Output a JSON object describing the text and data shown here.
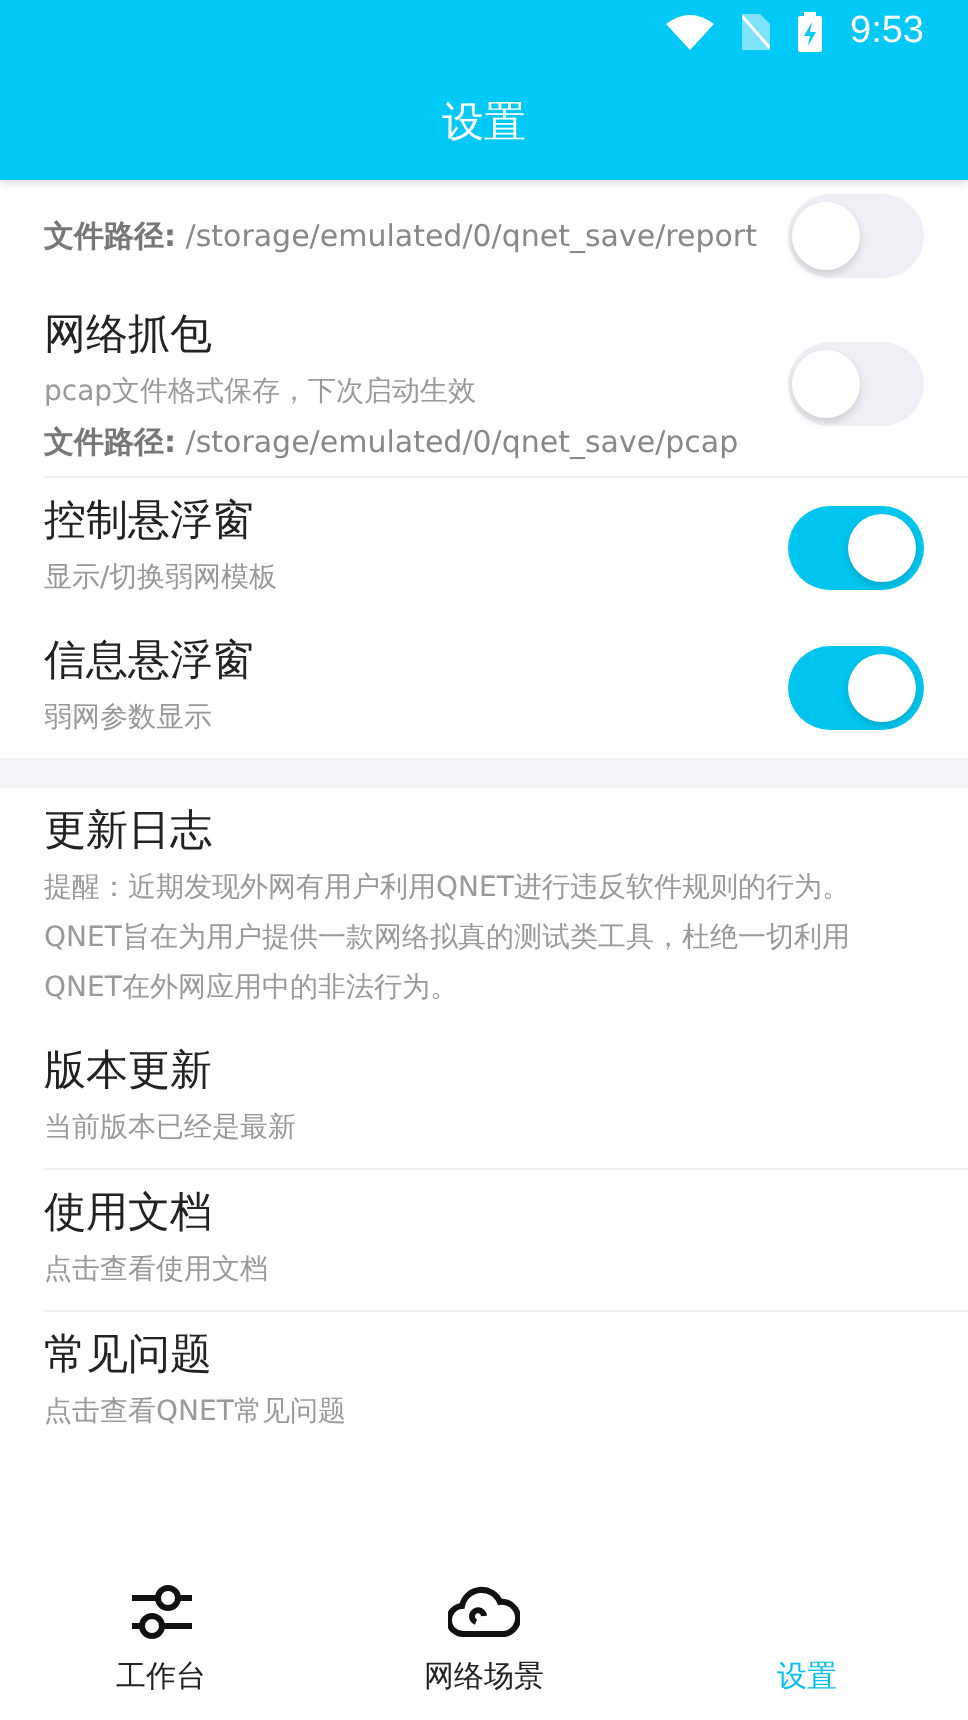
{
  "status_bar": {
    "time": "9:53"
  },
  "header": {
    "title": "设置"
  },
  "sections": [
    {
      "items": [
        {
          "kind": "toggle",
          "path": "**文件路径:** /storage/emulated/0/qnet_save/report",
          "on": false
        },
        {
          "kind": "toggle",
          "title": "网络抓包",
          "description": "pcap文件格式保存，下次启动生效",
          "path": "**文件路径:** /storage/emulated/0/qnet_save/pcap",
          "on": false
        },
        {
          "kind": "toggle",
          "title": "控制悬浮窗",
          "description": "显示/切换弱网模板",
          "on": true
        },
        {
          "kind": "toggle",
          "title": "信息悬浮窗",
          "description": "弱网参数显示",
          "on": true
        }
      ]
    },
    {
      "items": [
        {
          "kind": "link",
          "title": "更新日志",
          "description": "提醒：近期发现外网有用户利用QNET进行违反软件规则的行为。QNET旨在为用户提供一款网络拟真的测试类工具，杜绝一切利用QNET在外网应用中的非法行为。"
        },
        {
          "kind": "link",
          "title": "版本更新",
          "description": "当前版本已经是最新"
        },
        {
          "kind": "link",
          "title": "使用文档",
          "description": "点击查看使用文档"
        },
        {
          "kind": "link",
          "title": "常见问题",
          "description": "点击查看QNET常见问题"
        }
      ]
    }
  ],
  "nav": [
    {
      "label": "工作台",
      "kind": "sliders",
      "selected": false
    },
    {
      "label": "网络场景",
      "kind": "cloud",
      "selected": false
    },
    {
      "label": "设置",
      "kind": "plain",
      "selected": true
    }
  ]
}
